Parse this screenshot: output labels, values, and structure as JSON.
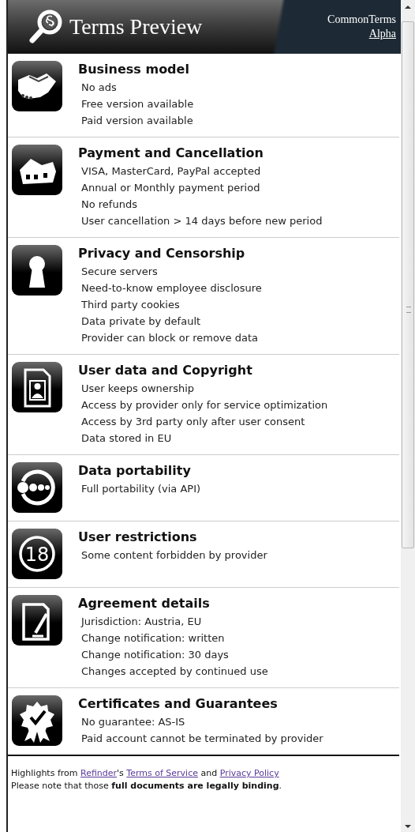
{
  "header": {
    "title": "Terms Preview",
    "brand": "CommonTerms",
    "version_link": "Alpha"
  },
  "sections": [
    {
      "kind": "handshake",
      "title": "Business model",
      "items": [
        "No ads",
        "Free version available",
        "Paid version available"
      ]
    },
    {
      "kind": "houses",
      "title": "Payment and Cancellation",
      "items": [
        "VISA, MasterCard, PayPal accepted",
        "Annual or Monthly payment period",
        "No refunds",
        "User cancellation > 14 days before new period"
      ]
    },
    {
      "kind": "keyhole",
      "title": "Privacy and Censorship",
      "items": [
        "Secure servers",
        "Need-to-know employee disclosure",
        "Third party cookies",
        "Data private by default",
        "Provider can block or remove data"
      ]
    },
    {
      "kind": "person-document",
      "title": "User data and Copyright",
      "items": [
        "User keeps ownership",
        "Access by provider only for service optimization",
        "Access by 3rd party only after user consent",
        "Data stored in EU"
      ]
    },
    {
      "kind": "portability",
      "title": "Data portability",
      "items": [
        "Full portability (via API)"
      ]
    },
    {
      "kind": "age",
      "icon_text": "18",
      "title": "User restrictions",
      "items": [
        "Some content forbidden by provider"
      ]
    },
    {
      "kind": "document-pen",
      "title": "Agreement details",
      "items": [
        "Jurisdiction: Austria, EU",
        "Change notification: written",
        "Change notification: 30 days",
        "Changes accepted by continued use"
      ]
    },
    {
      "kind": "rosette",
      "title": "Certificates and Guarantees",
      "items": [
        "No guarantee: AS-IS",
        "Paid account cannot be terminated by provider"
      ]
    }
  ],
  "footer": {
    "line1": [
      {
        "text": "Highlights from ",
        "link": false
      },
      {
        "text": "Refinder",
        "link": true
      },
      {
        "text": "'s ",
        "link": false
      },
      {
        "text": "Terms of Service",
        "link": true
      },
      {
        "text": " and ",
        "link": false
      },
      {
        "text": "Privacy Policy",
        "link": true
      }
    ],
    "line2": "Please note that those **full documents are legally binding**."
  }
}
